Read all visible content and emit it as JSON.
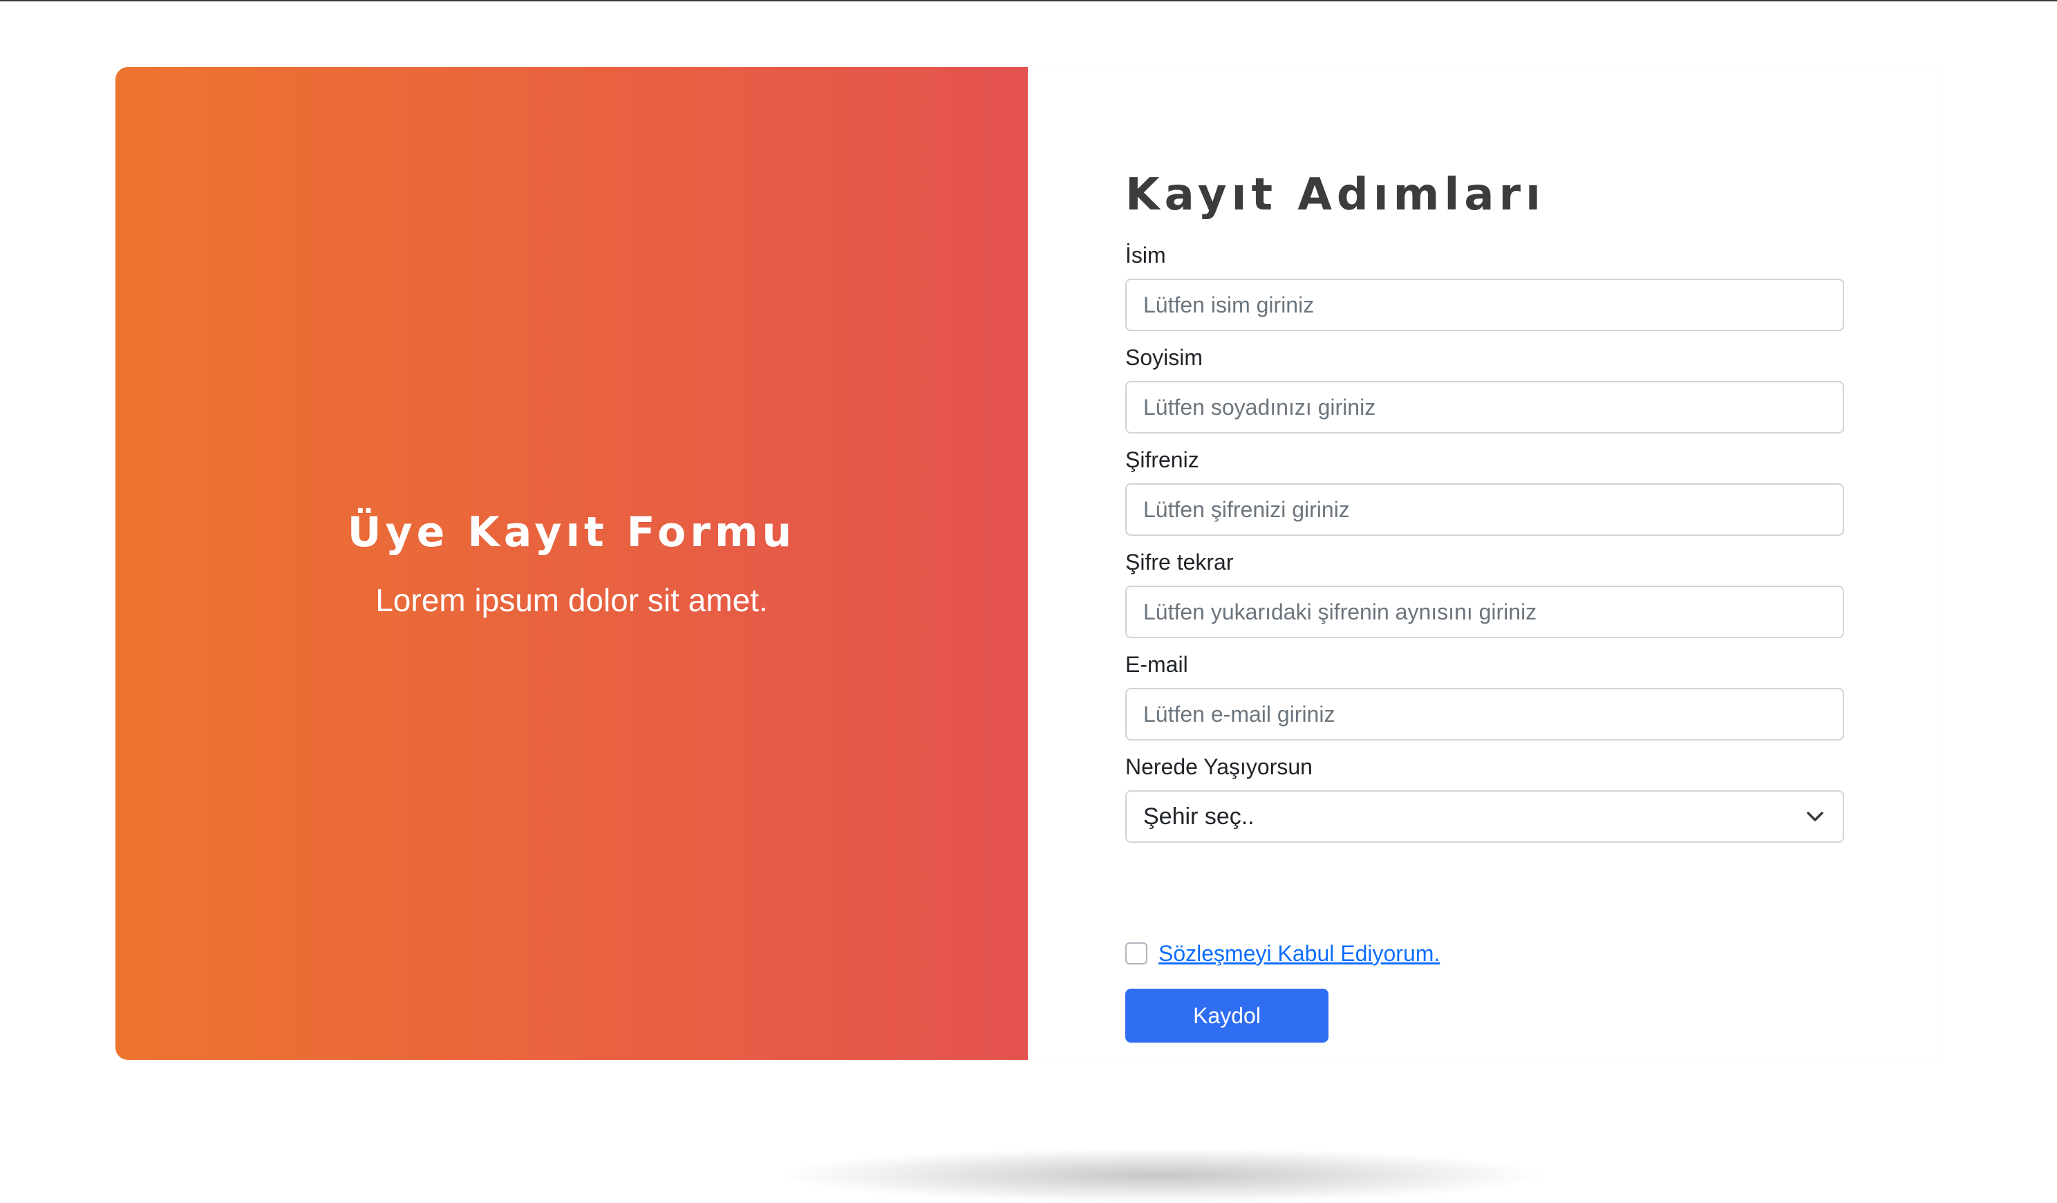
{
  "hero": {
    "title": "Üye Kayıt Formu",
    "subtitle": "Lorem ipsum dolor sit amet."
  },
  "form": {
    "title": "Kayıt Adımları",
    "fields": [
      {
        "label": "İsim",
        "placeholder": "Lütfen isim giriniz",
        "value": ""
      },
      {
        "label": "Soyisim",
        "placeholder": "Lütfen soyadınızı giriniz",
        "value": ""
      },
      {
        "label": "Şifreniz",
        "placeholder": "Lütfen şifrenizi giriniz",
        "value": ""
      },
      {
        "label": "Şifre tekrar",
        "placeholder": "Lütfen yukarıdaki şifrenin aynısını giriniz",
        "value": ""
      },
      {
        "label": "E-mail",
        "placeholder": "Lütfen e-mail giriniz",
        "value": ""
      }
    ],
    "city": {
      "label": "Nerede Yaşıyorsun",
      "selected": "Şehir seç..",
      "icon": "chevron-down-icon"
    },
    "agreement": {
      "label": "Sözleşmeyi Kabul Ediyorum.",
      "checked": false
    },
    "submit_label": "Kaydol"
  },
  "colors": {
    "gradient_start": "#ed742f",
    "gradient_end": "#e4524f",
    "primary_button": "#2f6df3",
    "link": "#0d6efd"
  }
}
